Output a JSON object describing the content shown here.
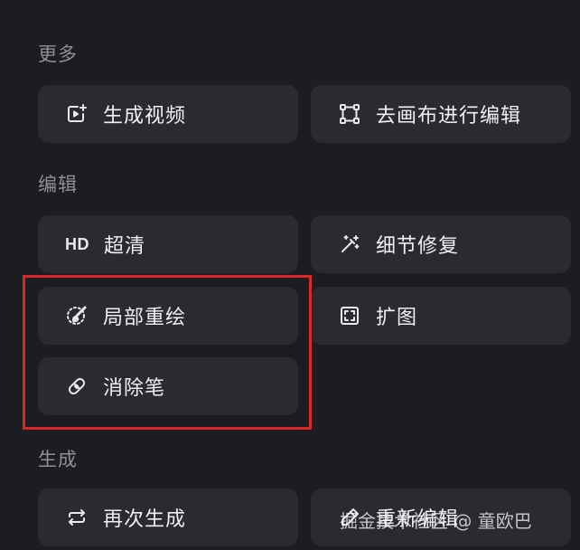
{
  "sections": {
    "more": {
      "title": "更多"
    },
    "edit": {
      "title": "编辑"
    },
    "generate": {
      "title": "生成"
    }
  },
  "buttons": {
    "generate_video": {
      "label": "生成视频",
      "icon": "video-plus-icon"
    },
    "canvas_edit": {
      "label": "去画布进行编辑",
      "icon": "crop-frame-icon"
    },
    "hd": {
      "icon_text": "HD",
      "label": "超清",
      "icon": "hd-icon"
    },
    "detail_repair": {
      "label": "细节修复",
      "icon": "magic-wand-icon"
    },
    "inpaint": {
      "label": "局部重绘",
      "icon": "brush-circle-icon"
    },
    "expand": {
      "label": "扩图",
      "icon": "expand-frame-icon"
    },
    "eraser": {
      "label": "消除笔",
      "icon": "eraser-icon"
    },
    "regenerate": {
      "label": "再次生成",
      "icon": "repeat-icon"
    },
    "re_edit": {
      "label": "重新编辑",
      "icon": "pen-icon"
    }
  },
  "watermark": {
    "text": "掘金技术社区 @ 童欧巴"
  },
  "colors": {
    "background": "#1c1d21",
    "button_bg": "#2a2b30",
    "highlight": "#d8262c",
    "muted_text": "#8d9096"
  }
}
